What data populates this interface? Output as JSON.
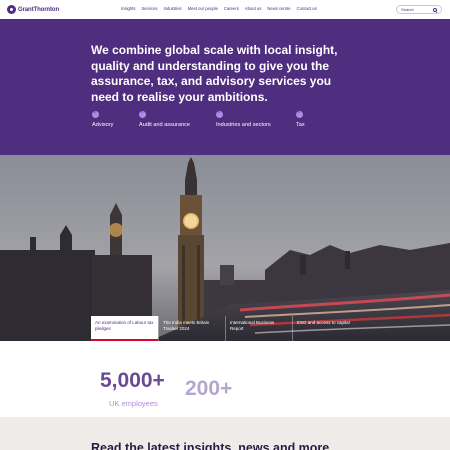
{
  "header": {
    "logo_text": "GrantThornton",
    "nav": [
      "Insights",
      "Services",
      "Industries",
      "Meet our people",
      "Careers",
      "About us",
      "News centre",
      "Contact us"
    ],
    "search_placeholder": "Search"
  },
  "hero": {
    "title": "We combine global scale with local insight, quality and understanding to give you the assurance, tax, and advisory services you need to realise your ambitions.",
    "services": [
      "Advisory",
      "Audit and assurance",
      "Industries and sectors",
      "Tax"
    ]
  },
  "feature_tabs": [
    "An examination of Labour tax pledges",
    "The India meets Britain Tracker 2024",
    "International Business Report",
    "ESG and access to capital"
  ],
  "stats": {
    "stat1_value": "5,000+",
    "stat1_label": "UK employees",
    "stat2_value": "200+"
  },
  "insights": {
    "title": "Read the latest insights, news and more"
  },
  "colors": {
    "brand_purple": "#4f2d7f",
    "light_purple": "#b08be0",
    "accent_red": "#de002e"
  }
}
